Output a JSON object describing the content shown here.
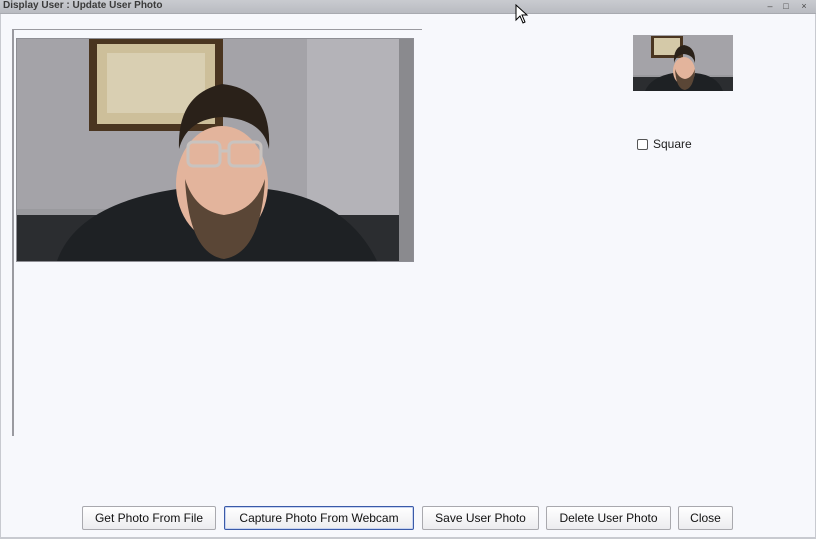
{
  "window": {
    "title": "Display User : Update User Photo",
    "controls": [
      "minimize-icon",
      "maximize-icon",
      "close-icon"
    ],
    "control_glyphs": {
      "minimize": "–",
      "maximize": "□",
      "close": "×"
    }
  },
  "options": {
    "square_label": "Square",
    "square_checked": false
  },
  "buttons": {
    "get_from_file": "Get Photo From File",
    "capture_webcam": "Capture Photo From Webcam",
    "save": "Save User Photo",
    "delete": "Delete User Photo",
    "close": "Close"
  },
  "colors": {
    "background": "#f7f8fc",
    "titlebar": "#c9cbd0",
    "focus_border": "#3a5aa8"
  }
}
